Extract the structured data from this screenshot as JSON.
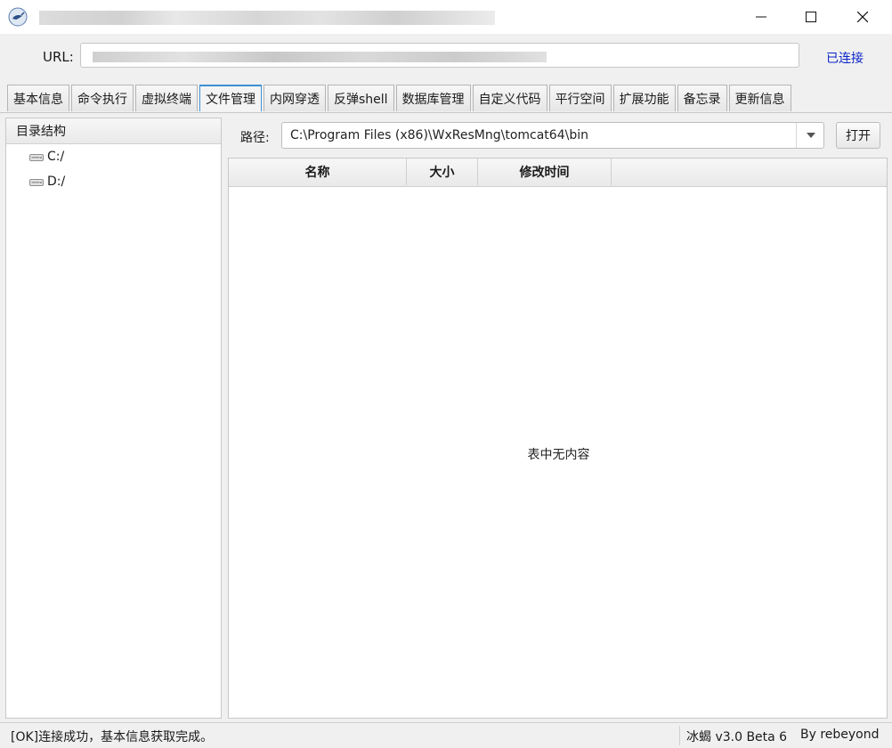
{
  "url_bar": {
    "label": "URL:",
    "value": "",
    "status": "已连接",
    "status_color": "#0a24c8"
  },
  "tabs": [
    {
      "label": "基本信息"
    },
    {
      "label": "命令执行"
    },
    {
      "label": "虚拟终端"
    },
    {
      "label": "文件管理",
      "active": true
    },
    {
      "label": "内网穿透"
    },
    {
      "label": "反弹shell"
    },
    {
      "label": "数据库管理"
    },
    {
      "label": "自定义代码"
    },
    {
      "label": "平行空间"
    },
    {
      "label": "扩展功能"
    },
    {
      "label": "备忘录"
    },
    {
      "label": "更新信息"
    }
  ],
  "dir_tree": {
    "header": "目录结构",
    "items": [
      {
        "label": "C:/",
        "icon": "drive-icon"
      },
      {
        "label": "D:/",
        "icon": "drive-icon"
      }
    ]
  },
  "path_bar": {
    "label": "路径:",
    "value": "C:\\Program Files (x86)\\WxResMng\\tomcat64\\bin",
    "open_label": "打开"
  },
  "file_table": {
    "columns": [
      "名称",
      "大小",
      "修改时间"
    ],
    "rows": [],
    "empty_message": "表中无内容"
  },
  "status_bar": {
    "message": "[OK]连接成功，基本信息获取完成。",
    "version": "冰蝎 v3.0 Beta 6",
    "author": "By rebeyond"
  },
  "icons": {
    "app": "scorpion-logo-icon",
    "minimize": "minimize-icon",
    "maximize": "maximize-icon",
    "close": "close-icon",
    "drive": "drive-icon",
    "dropdown": "chevron-down-icon"
  },
  "colors": {
    "active_tab_border": "#3d8fd6",
    "window_bg": "#f0f0f0"
  }
}
